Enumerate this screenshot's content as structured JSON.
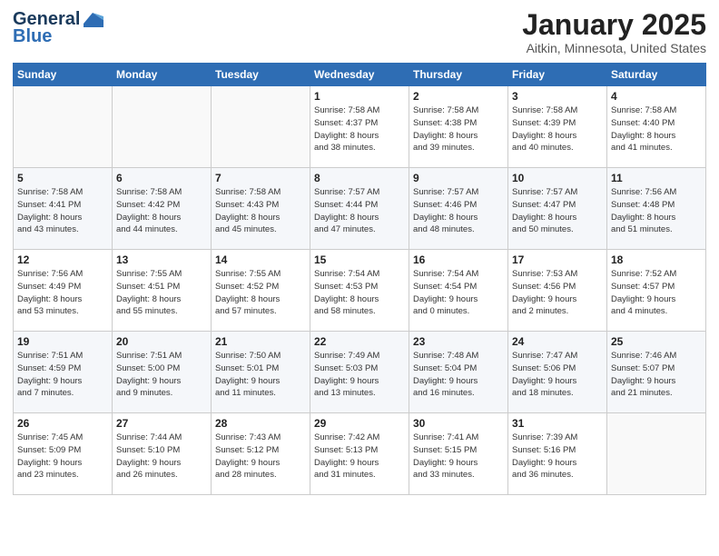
{
  "logo": {
    "general": "General",
    "blue": "Blue"
  },
  "header": {
    "title": "January 2025",
    "subtitle": "Aitkin, Minnesota, United States"
  },
  "days_of_week": [
    "Sunday",
    "Monday",
    "Tuesday",
    "Wednesday",
    "Thursday",
    "Friday",
    "Saturday"
  ],
  "weeks": [
    [
      {
        "day": "",
        "info": ""
      },
      {
        "day": "",
        "info": ""
      },
      {
        "day": "",
        "info": ""
      },
      {
        "day": "1",
        "info": "Sunrise: 7:58 AM\nSunset: 4:37 PM\nDaylight: 8 hours\nand 38 minutes."
      },
      {
        "day": "2",
        "info": "Sunrise: 7:58 AM\nSunset: 4:38 PM\nDaylight: 8 hours\nand 39 minutes."
      },
      {
        "day": "3",
        "info": "Sunrise: 7:58 AM\nSunset: 4:39 PM\nDaylight: 8 hours\nand 40 minutes."
      },
      {
        "day": "4",
        "info": "Sunrise: 7:58 AM\nSunset: 4:40 PM\nDaylight: 8 hours\nand 41 minutes."
      }
    ],
    [
      {
        "day": "5",
        "info": "Sunrise: 7:58 AM\nSunset: 4:41 PM\nDaylight: 8 hours\nand 43 minutes."
      },
      {
        "day": "6",
        "info": "Sunrise: 7:58 AM\nSunset: 4:42 PM\nDaylight: 8 hours\nand 44 minutes."
      },
      {
        "day": "7",
        "info": "Sunrise: 7:58 AM\nSunset: 4:43 PM\nDaylight: 8 hours\nand 45 minutes."
      },
      {
        "day": "8",
        "info": "Sunrise: 7:57 AM\nSunset: 4:44 PM\nDaylight: 8 hours\nand 47 minutes."
      },
      {
        "day": "9",
        "info": "Sunrise: 7:57 AM\nSunset: 4:46 PM\nDaylight: 8 hours\nand 48 minutes."
      },
      {
        "day": "10",
        "info": "Sunrise: 7:57 AM\nSunset: 4:47 PM\nDaylight: 8 hours\nand 50 minutes."
      },
      {
        "day": "11",
        "info": "Sunrise: 7:56 AM\nSunset: 4:48 PM\nDaylight: 8 hours\nand 51 minutes."
      }
    ],
    [
      {
        "day": "12",
        "info": "Sunrise: 7:56 AM\nSunset: 4:49 PM\nDaylight: 8 hours\nand 53 minutes."
      },
      {
        "day": "13",
        "info": "Sunrise: 7:55 AM\nSunset: 4:51 PM\nDaylight: 8 hours\nand 55 minutes."
      },
      {
        "day": "14",
        "info": "Sunrise: 7:55 AM\nSunset: 4:52 PM\nDaylight: 8 hours\nand 57 minutes."
      },
      {
        "day": "15",
        "info": "Sunrise: 7:54 AM\nSunset: 4:53 PM\nDaylight: 8 hours\nand 58 minutes."
      },
      {
        "day": "16",
        "info": "Sunrise: 7:54 AM\nSunset: 4:54 PM\nDaylight: 9 hours\nand 0 minutes."
      },
      {
        "day": "17",
        "info": "Sunrise: 7:53 AM\nSunset: 4:56 PM\nDaylight: 9 hours\nand 2 minutes."
      },
      {
        "day": "18",
        "info": "Sunrise: 7:52 AM\nSunset: 4:57 PM\nDaylight: 9 hours\nand 4 minutes."
      }
    ],
    [
      {
        "day": "19",
        "info": "Sunrise: 7:51 AM\nSunset: 4:59 PM\nDaylight: 9 hours\nand 7 minutes."
      },
      {
        "day": "20",
        "info": "Sunrise: 7:51 AM\nSunset: 5:00 PM\nDaylight: 9 hours\nand 9 minutes."
      },
      {
        "day": "21",
        "info": "Sunrise: 7:50 AM\nSunset: 5:01 PM\nDaylight: 9 hours\nand 11 minutes."
      },
      {
        "day": "22",
        "info": "Sunrise: 7:49 AM\nSunset: 5:03 PM\nDaylight: 9 hours\nand 13 minutes."
      },
      {
        "day": "23",
        "info": "Sunrise: 7:48 AM\nSunset: 5:04 PM\nDaylight: 9 hours\nand 16 minutes."
      },
      {
        "day": "24",
        "info": "Sunrise: 7:47 AM\nSunset: 5:06 PM\nDaylight: 9 hours\nand 18 minutes."
      },
      {
        "day": "25",
        "info": "Sunrise: 7:46 AM\nSunset: 5:07 PM\nDaylight: 9 hours\nand 21 minutes."
      }
    ],
    [
      {
        "day": "26",
        "info": "Sunrise: 7:45 AM\nSunset: 5:09 PM\nDaylight: 9 hours\nand 23 minutes."
      },
      {
        "day": "27",
        "info": "Sunrise: 7:44 AM\nSunset: 5:10 PM\nDaylight: 9 hours\nand 26 minutes."
      },
      {
        "day": "28",
        "info": "Sunrise: 7:43 AM\nSunset: 5:12 PM\nDaylight: 9 hours\nand 28 minutes."
      },
      {
        "day": "29",
        "info": "Sunrise: 7:42 AM\nSunset: 5:13 PM\nDaylight: 9 hours\nand 31 minutes."
      },
      {
        "day": "30",
        "info": "Sunrise: 7:41 AM\nSunset: 5:15 PM\nDaylight: 9 hours\nand 33 minutes."
      },
      {
        "day": "31",
        "info": "Sunrise: 7:39 AM\nSunset: 5:16 PM\nDaylight: 9 hours\nand 36 minutes."
      },
      {
        "day": "",
        "info": ""
      }
    ]
  ]
}
